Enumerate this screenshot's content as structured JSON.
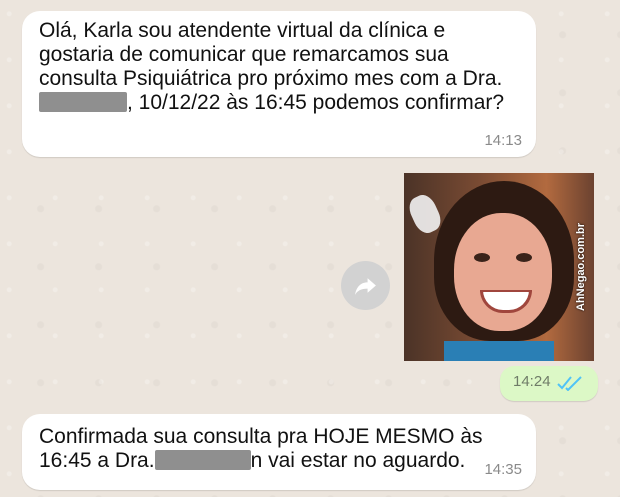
{
  "messages": [
    {
      "direction": "incoming",
      "text_part1": "Olá, Karla sou atendente virtual da clínica e gostaria de comunicar que remarcamos sua consulta Psiquiátrica pro próximo mes com a Dra. ",
      "text_part2": ", 10/12/22 às 16:45 podemos confirmar?",
      "time": "14:13"
    },
    {
      "direction": "outgoing",
      "type": "sticker",
      "time": "14:24",
      "status": "read"
    },
    {
      "direction": "incoming",
      "text_part1": "Confirmada sua consulta pra HOJE MESMO às 16:45 a Dra.",
      "text_part2": "n vai estar no aguardo.",
      "time": "14:35"
    }
  ],
  "watermark": "AhNegao.com.br",
  "colors": {
    "chat_bg": "#ece5dd",
    "incoming_bubble": "#ffffff",
    "outgoing_bubble": "#dcf8c6",
    "read_ticks": "#4fc3f7"
  },
  "icons": [
    "forward-icon",
    "double-check-icon"
  ]
}
